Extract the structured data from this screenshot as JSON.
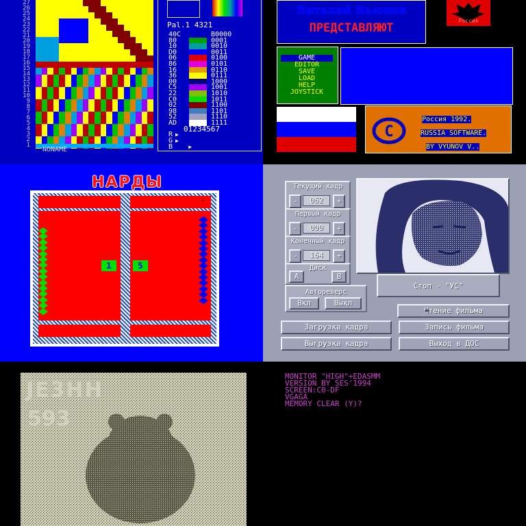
{
  "editor": {
    "row_numbers": [
      "27",
      "26",
      "25",
      "24",
      "23",
      "22",
      "21",
      "20",
      "19",
      "18",
      "17",
      "16",
      "15",
      "14",
      "13",
      "12",
      "11",
      "10",
      "9",
      "8",
      "7",
      "6",
      "5",
      "4",
      "3",
      "2",
      "1"
    ],
    "palette_title": "Pal.1 4321",
    "palette_rows": [
      {
        "code": "40C",
        "color": "#0000c0",
        "bin": "B0000"
      },
      {
        "code": "80",
        "color": "#00a000",
        "bin": "0001"
      },
      {
        "code": "10",
        "color": "#00a0a0",
        "bin": "0010"
      },
      {
        "code": "D0",
        "color": "#0000ff",
        "bin": "0011"
      },
      {
        "code": "06",
        "color": "#e00000",
        "bin": "0100"
      },
      {
        "code": "86",
        "color": "#e000e0",
        "bin": "0101"
      },
      {
        "code": "16",
        "color": "#e0a000",
        "bin": "0110"
      },
      {
        "code": "36",
        "color": "#ffff00",
        "bin": "0111"
      },
      {
        "code": "00",
        "color": "#000080",
        "bin": "1000"
      },
      {
        "code": "C5",
        "color": "#a000ff",
        "bin": "1001"
      },
      {
        "code": "22",
        "color": "#80c000",
        "bin": "1010"
      },
      {
        "code": "C0",
        "color": "#00e000",
        "bin": "1011"
      },
      {
        "code": "02",
        "color": "#800000",
        "bin": "1100"
      },
      {
        "code": "98",
        "color": "#4080c0",
        "bin": "1101"
      },
      {
        "code": "52",
        "color": "#a0a0c0",
        "bin": "1110"
      },
      {
        "code": "AD",
        "color": "#ffffff",
        "bin": "1111"
      }
    ],
    "digits": "01234567",
    "rgb_labels": [
      "R",
      "G",
      "B"
    ],
    "filename": "NONAME"
  },
  "title_screen": {
    "author": "Виталий Вьюнов",
    "presents": "ПРЕДСТАВЛЯЮТ",
    "logo_caption": "Россия",
    "menu": [
      "GAME",
      "EDITOR",
      "SAVE",
      "LOAD",
      "HELP",
      "JOYSTICK"
    ],
    "menu_selected": "GAME",
    "info_lines": [
      "Россия 1992.",
      "RUSSIA SOFTWARE.",
      "BY VYUNOV V.."
    ],
    "copyright_symbol": "C"
  },
  "nardy": {
    "title": "НАРДЫ",
    "dice": [
      "1",
      "5"
    ],
    "colors": {
      "board": "#ff0000",
      "frame": "#ffffff",
      "white_pieces": "#00e000",
      "black_pieces": "#0000ff"
    }
  },
  "video_ui": {
    "current_frame": {
      "label": "Текущий кадр",
      "value": "062",
      "minus": "-",
      "plus": "+"
    },
    "first_frame": {
      "label": "Первый кадр",
      "value": "000",
      "minus": "-",
      "plus": "+"
    },
    "last_frame": {
      "label": "Конечный кадр",
      "value": "164",
      "minus": "-",
      "plus": "+"
    },
    "disk": {
      "label": "Диск",
      "a": "A",
      "b": "B"
    },
    "autoreverse": {
      "label": "Автореверс",
      "on": "Вкл",
      "off": "Выкл"
    },
    "status": "Стоп - \"УС\"",
    "buttons": [
      "Чтение фильма",
      "Загрузка кадра",
      "Запись фильма",
      "Выгрузка кадра",
      "Выход в ДОС"
    ]
  },
  "noisy_image": {
    "overlay_text": [
      "JE3HH",
      "593"
    ]
  },
  "monitor": {
    "lines": [
      "MONITOR \"HIGH\"+EDASMM",
      "VERSION BY SES'1994",
      "SCREEN:C0-DF",
      "VGAGA",
      "MEMORY CLEAR (Y)?"
    ]
  }
}
